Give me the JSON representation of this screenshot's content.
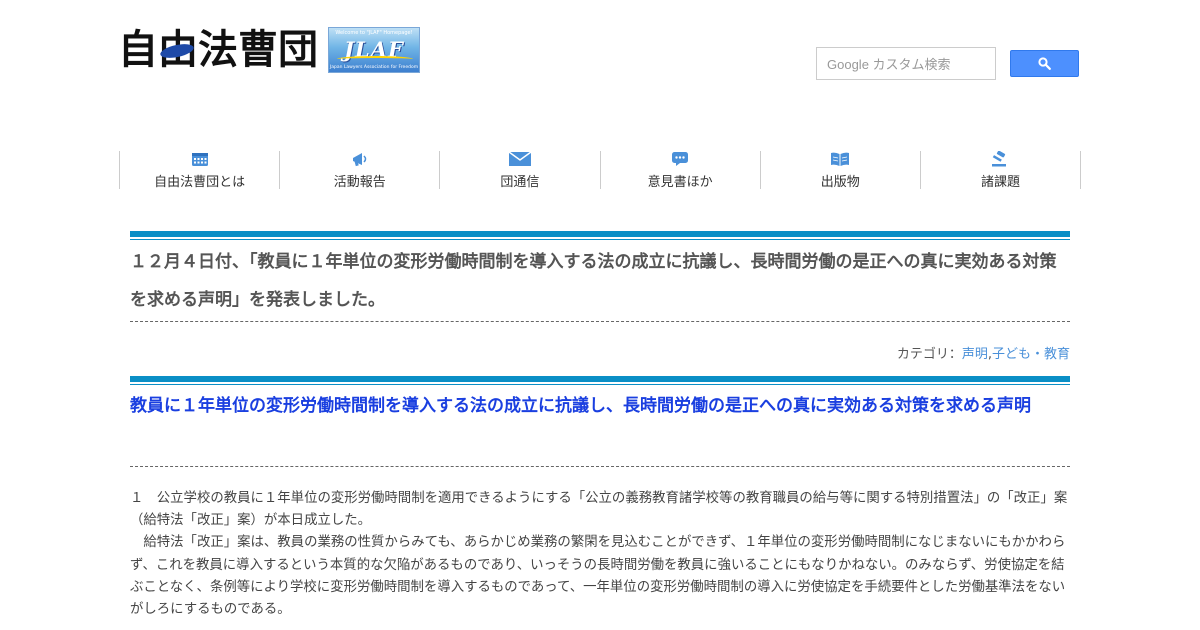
{
  "header": {
    "logo_text": "自由法曹団",
    "badge": {
      "top_text": "Welcome to \"JLAF\" Homepage!",
      "main_text": "JLAF",
      "sub_text": "Japan Lawyers Association for Freedom"
    }
  },
  "search": {
    "placeholder": "Google カスタム検索",
    "button_icon": "search-icon",
    "button_color": "#4d90fe"
  },
  "nav": {
    "items": [
      {
        "label": "自由法曹団とは",
        "icon": "calendar-icon"
      },
      {
        "label": "活動報告",
        "icon": "megaphone-icon"
      },
      {
        "label": "団通信",
        "icon": "envelope-icon"
      },
      {
        "label": "意見書ほか",
        "icon": "speech-bubble-icon"
      },
      {
        "label": "出版物",
        "icon": "book-icon"
      },
      {
        "label": "諸課題",
        "icon": "gavel-icon"
      }
    ],
    "icon_color": "#4a90d9"
  },
  "post": {
    "title": "１２月４日付、「教員に１年単位の変形労働時間制を導入する法の成立に抗議し、長時間労働の是正への真に実効ある対策を求める声明」を発表しました。",
    "category_label": "カテゴリ：",
    "categories": [
      "声明",
      "子ども・教育"
    ],
    "category_separator": ","
  },
  "article": {
    "title": "教員に１年単位の変形労働時間制を導入する法の成立に抗議し、長時間労働の是正への真に実効ある対策を求める声明",
    "paragraphs": [
      "１　公立学校の教員に１年単位の変形労働時間制を適用できるようにする「公立の義務教育諸学校等の教育職員の給与等に関する特別措置法」の「改正」案（給特法「改正」案）が本日成立した。",
      "　給特法「改正」案は、教員の業務の性質からみても、あらかじめ業務の繁閑を見込むことができず、１年単位の変形労働時間制になじまないにもかかわらず、これを教員に導入するという本質的な欠陥があるものであり、いっそうの長時間労働を教員に強いることにもなりかねない。のみならず、労使協定を結ぶことなく、条例等により学校に変形労働時間制を導入するものであって、一年単位の変形労働時間制の導入に労使協定を手続要件とした労働基準法をないがしろにするものである。"
    ]
  },
  "colors": {
    "accent_rule": "#0a8fc6",
    "article_title": "#1a3fe0",
    "link": "#4a90d9"
  }
}
